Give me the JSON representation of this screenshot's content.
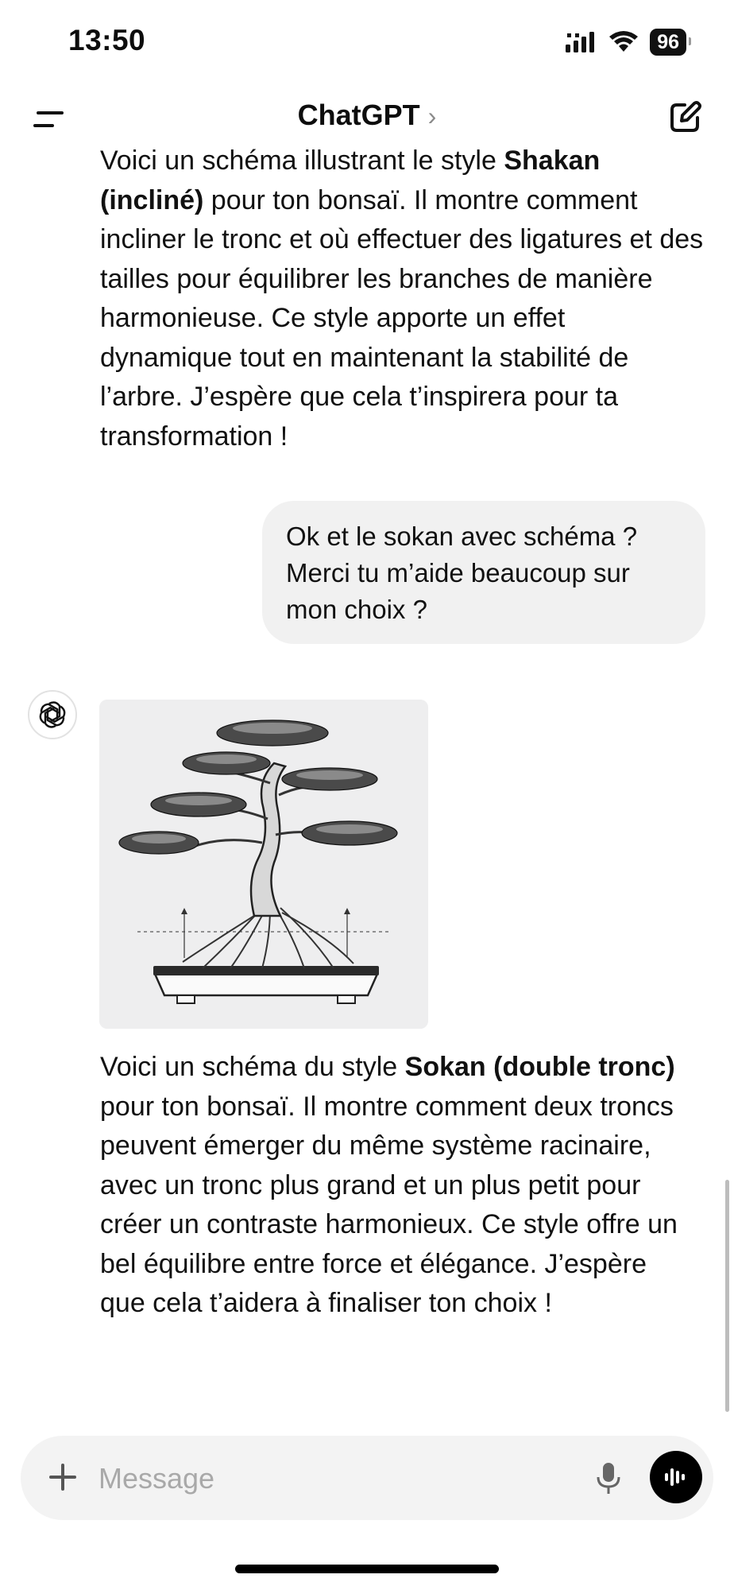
{
  "status_bar": {
    "time": "13:50",
    "battery": "96",
    "icons": [
      "signal-icon",
      "wifi-icon",
      "battery-icon"
    ]
  },
  "header": {
    "title": "ChatGPT",
    "chevron": "›",
    "left_icon": "menu-icon",
    "right_icon": "new-chat-icon"
  },
  "messages": {
    "assistant_1": {
      "line_1a": "Voici un schéma illustrant le style ",
      "line_1b": "Shakan",
      "line_2a": "(incliné)",
      "line_2b": " pour ton bonsaï. Il montre comment incliner le tronc et où effectuer des ligatures et des tailles pour équilibrer les branches de manière harmonieuse. Ce style apporte un effet dynamique tout en maintenant la stabilité de l’arbre. J’espère que cela t’inspirera pour ta transformation !"
    },
    "user_1": {
      "text": "Ok et le sokan avec schéma ? Merci tu m’aide beaucoup sur mon choix ?"
    },
    "assistant_2": {
      "intro": "Voici un schéma du style ",
      "bold": "Sokan (double tronc)",
      "rest": " pour ton bonsaï. Il montre comment deux troncs peuvent émerger du même système racinaire, avec un tronc plus grand et un plus petit pour créer un contraste harmonieux. Ce style offre un bel équilibre entre force et élégance. J’espère que cela t’aidera à finaliser ton choix !"
    }
  },
  "composer": {
    "placeholder": "Message",
    "icons": [
      "plus-icon",
      "microphone-icon",
      "voice-mode-icon"
    ]
  },
  "colors": {
    "bubble": "#f1f1f1",
    "composer": "#f3f3f3",
    "placeholder": "#a9a9a9",
    "image_bg": "#eeeeef"
  }
}
